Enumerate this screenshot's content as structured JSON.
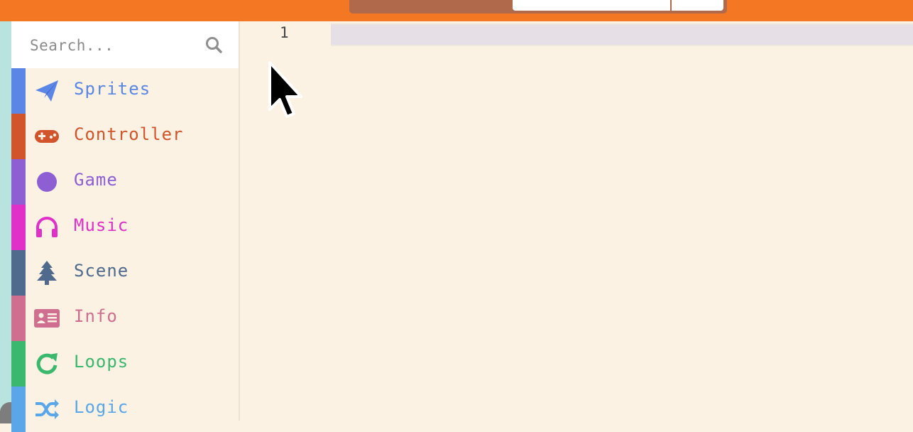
{
  "search": {
    "placeholder": "Search..."
  },
  "categories": [
    {
      "label": "Sprites",
      "color": "#5b86e5",
      "icon": "paper-plane-icon"
    },
    {
      "label": "Controller",
      "color": "#d2542a",
      "icon": "gamepad-icon"
    },
    {
      "label": "Game",
      "color": "#8d5fd3",
      "icon": "circle-icon"
    },
    {
      "label": "Music",
      "color": "#e030c8",
      "icon": "headphones-icon"
    },
    {
      "label": "Scene",
      "color": "#4f6a8c",
      "icon": "tree-icon"
    },
    {
      "label": "Info",
      "color": "#cf6e8e",
      "icon": "id-card-icon"
    },
    {
      "label": "Loops",
      "color": "#3ab86d",
      "icon": "refresh-icon"
    },
    {
      "label": "Logic",
      "color": "#5aa6e8",
      "icon": "shuffle-icon"
    }
  ],
  "editor": {
    "line_number": "1"
  },
  "colors": {
    "topbar": "#f47824",
    "workspace": "#fbf2e4",
    "left_strip": "#b9e3df"
  }
}
